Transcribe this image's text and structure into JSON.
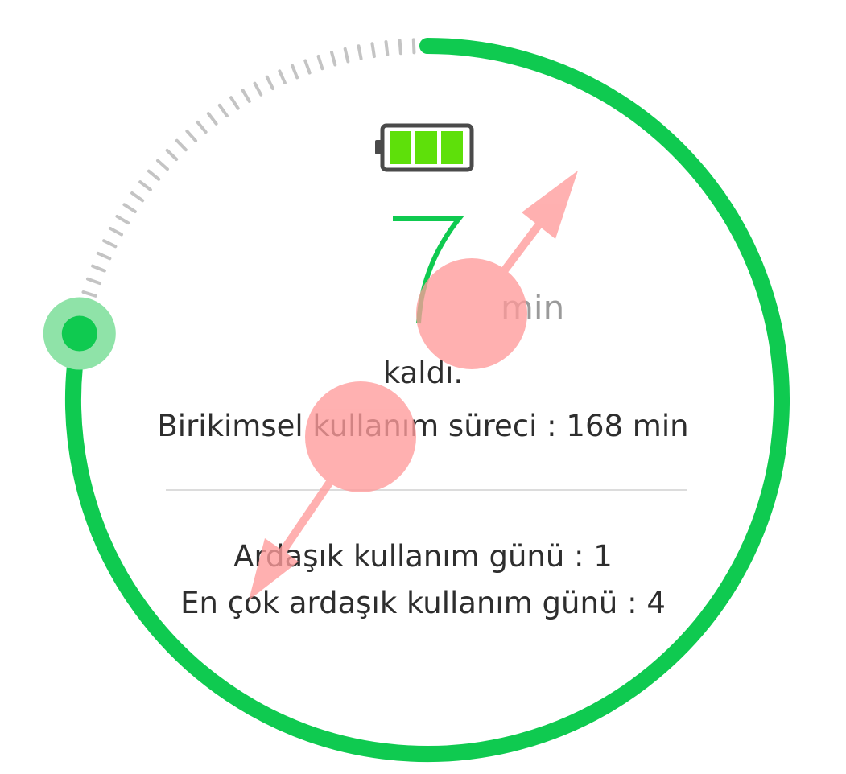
{
  "timer": {
    "remaining_value": "7",
    "remaining_unit": "min",
    "remaining_label": "kaldı.",
    "progress_fraction": 0.78
  },
  "stats": {
    "cumulative": "Birikimsel kullanım süreci : 168 min",
    "consecutive_days": "Ardaşık kullanım günü : 1",
    "max_consecutive_days": "En çok ardaşık kullanım günü : 4"
  },
  "battery": {
    "level_bars": 3,
    "max_bars": 3
  },
  "colors": {
    "accent": "#0fca50",
    "handle_halo": "#8fe3a8",
    "tick": "#c4c4c4",
    "battery_fill": "#5ee00a",
    "text": "#2e2e2e",
    "unit": "#9a9a9a",
    "touch_overlay": "#ff9b9b"
  }
}
